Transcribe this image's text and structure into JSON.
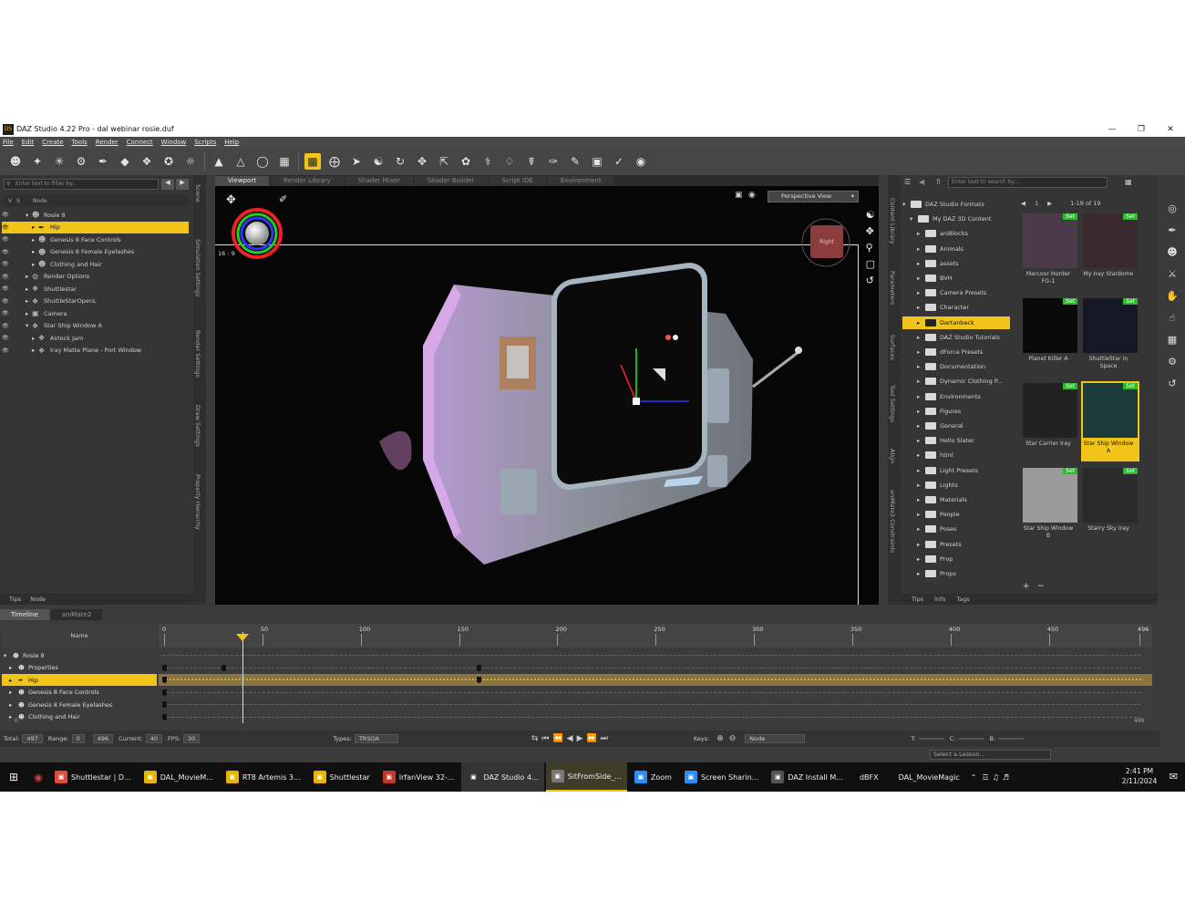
{
  "window": {
    "title": "DAZ Studio 4.22 Pro - dal webinar rosie.duf",
    "app_icon": "DS"
  },
  "menu": [
    "File",
    "Edit",
    "Create",
    "Tools",
    "Render",
    "Connect",
    "Window",
    "Scripts",
    "Help"
  ],
  "scene": {
    "filter_placeholder": "Enter text to filter by...",
    "header": {
      "v": "V",
      "s": "S",
      "node": "Node"
    },
    "rows": [
      {
        "label": "Rosie 8",
        "indent": 0,
        "expanded": true,
        "selected": false
      },
      {
        "label": "Hip",
        "indent": 1,
        "expanded": false,
        "selected": true
      },
      {
        "label": "Genesis 8 Face Controls",
        "indent": 1,
        "expanded": false,
        "selected": false
      },
      {
        "label": "Genesis 8 Female Eyelashes",
        "indent": 1,
        "expanded": false,
        "selected": false
      },
      {
        "label": "Clothing and Hair",
        "indent": 1,
        "expanded": false,
        "selected": false
      },
      {
        "label": "Render Options",
        "indent": 0,
        "expanded": false,
        "selected": false
      },
      {
        "label": "Shuttlestar",
        "indent": 0,
        "expanded": false,
        "selected": false
      },
      {
        "label": "ShuttleStarOpenL",
        "indent": 0,
        "expanded": false,
        "selected": false
      },
      {
        "label": "Camera",
        "indent": 0,
        "expanded": false,
        "selected": false
      },
      {
        "label": "Star Ship Window A",
        "indent": 0,
        "expanded": true,
        "selected": false
      },
      {
        "label": "Airlock Jam",
        "indent": 1,
        "expanded": false,
        "selected": false
      },
      {
        "label": "Iray Matte Plane - Port Window",
        "indent": 1,
        "expanded": false,
        "selected": false
      }
    ],
    "side_tabs": [
      "Scene",
      "Simulation Settings",
      "Render Settings",
      "Draw Settings",
      "Property Hierarchy"
    ],
    "bottom_tabs": [
      "Tips",
      "Node"
    ]
  },
  "viewport": {
    "tabs": [
      "Viewport",
      "Render Library",
      "Shader Mixer",
      "Shader Builder",
      "Script IDE",
      "Environment"
    ],
    "active_tab": "Viewport",
    "view_select": "Perspective View",
    "aspect": "16 : 9",
    "cube_label": "Right"
  },
  "content": {
    "side_tabs": [
      "Content Library",
      "Parameters",
      "Surfaces",
      "Tool Settings",
      "Align",
      "aniMate2 Constraints"
    ],
    "search_placeholder": "Enter text to search by...",
    "page": "1",
    "range": "1-19 of 19",
    "tree": [
      {
        "label": "DAZ Studio Formats",
        "indent": 0,
        "selected": false
      },
      {
        "label": "My DAZ 3D Content",
        "indent": 1,
        "selected": false
      },
      {
        "label": "aniBlocks",
        "indent": 2,
        "selected": false
      },
      {
        "label": "Animals",
        "indent": 2,
        "selected": false
      },
      {
        "label": "assets",
        "indent": 2,
        "selected": false
      },
      {
        "label": "BVH",
        "indent": 2,
        "selected": false
      },
      {
        "label": "Camera Presets",
        "indent": 2,
        "selected": false
      },
      {
        "label": "Character",
        "indent": 2,
        "selected": false
      },
      {
        "label": "Dartanbeck",
        "indent": 2,
        "selected": true
      },
      {
        "label": "DAZ Studio Tutorials",
        "indent": 2,
        "selected": false
      },
      {
        "label": "dForce Presets",
        "indent": 2,
        "selected": false
      },
      {
        "label": "Documentation",
        "indent": 2,
        "selected": false
      },
      {
        "label": "Dynamic Clothing P...",
        "indent": 2,
        "selected": false
      },
      {
        "label": "Environments",
        "indent": 2,
        "selected": false
      },
      {
        "label": "Figures",
        "indent": 2,
        "selected": false
      },
      {
        "label": "General",
        "indent": 2,
        "selected": false
      },
      {
        "label": "Hello Slater",
        "indent": 2,
        "selected": false
      },
      {
        "label": "html",
        "indent": 2,
        "selected": false
      },
      {
        "label": "Light Presets",
        "indent": 2,
        "selected": false
      },
      {
        "label": "Lights",
        "indent": 2,
        "selected": false
      },
      {
        "label": "Materials",
        "indent": 2,
        "selected": false
      },
      {
        "label": "People",
        "indent": 2,
        "selected": false
      },
      {
        "label": "Poses",
        "indent": 2,
        "selected": false
      },
      {
        "label": "Presets",
        "indent": 2,
        "selected": false
      },
      {
        "label": "Prop",
        "indent": 2,
        "selected": false
      },
      {
        "label": "Props",
        "indent": 2,
        "selected": false
      }
    ],
    "set_badge": "Set",
    "thumbs": [
      {
        "label": "Marcoor Hunter FG-1",
        "selected": false,
        "bg": "#4a3a4a"
      },
      {
        "label": "My Iray Stardome",
        "selected": false,
        "bg": "#3a2a30"
      },
      {
        "label": "Planet Killer A",
        "selected": false,
        "bg": "#0a0a0a"
      },
      {
        "label": "ShuttleStar in Space",
        "selected": false,
        "bg": "#151822"
      },
      {
        "label": "Star Carrier Iray",
        "selected": false,
        "bg": "#222"
      },
      {
        "label": "Star Ship Window A",
        "selected": true,
        "bg": "#1d3a3a"
      },
      {
        "label": "Star Ship Window B",
        "selected": false,
        "bg": "#9a9a9a"
      },
      {
        "label": "Starry Sky Iray",
        "selected": false,
        "bg": "#2a2a2a"
      }
    ],
    "bottom_tabs": [
      "Tips",
      "Info",
      "Tags"
    ]
  },
  "timeline": {
    "tabs": [
      "Timeline",
      "aniMate2"
    ],
    "name_header": "Name",
    "ticks": [
      "0",
      "50",
      "100",
      "150",
      "200",
      "250",
      "300",
      "350",
      "400",
      "450",
      "496"
    ],
    "rows": [
      {
        "label": "Rosie 8",
        "selected": false,
        "keys": []
      },
      {
        "label": "Properties",
        "selected": false,
        "keys": [
          0,
          30,
          160
        ]
      },
      {
        "label": "Hip",
        "selected": true,
        "keys": [
          0,
          160
        ]
      },
      {
        "label": "Genesis 8 Face Controls",
        "selected": false,
        "keys": [
          0
        ]
      },
      {
        "label": "Genesis 8 Female Eyelashes",
        "selected": false,
        "keys": [
          0
        ]
      },
      {
        "label": "Clothing and Hair",
        "selected": false,
        "keys": [
          0
        ]
      }
    ],
    "scroll_start": "0",
    "scroll_end": "496",
    "current_frame": 40,
    "total_frames": 496,
    "status": {
      "total_label": "Total:",
      "total": "497",
      "range_label": "Range:",
      "range_start": "0",
      "range_end": "496",
      "current_label": "Current:",
      "current": "40",
      "fps_label": "FPS:",
      "fps": "30",
      "types_label": "Types:",
      "types": "TRSOA",
      "keys_label": "Keys:",
      "keys_mode": "Node",
      "t_label": "T:",
      "c_label": "C:",
      "b_label": "B:"
    }
  },
  "lesson_select": "Select a Lesson...",
  "taskbar": {
    "items": [
      {
        "label": "Shuttlestar | D...",
        "color": "#dd4b39",
        "active": false
      },
      {
        "label": "DAL_MovieM...",
        "color": "#e8b400",
        "active": false
      },
      {
        "label": "RT8 Artemis 3...",
        "color": "#e8b400",
        "active": false
      },
      {
        "label": "Shuttlestar",
        "color": "#e8b400",
        "active": false
      },
      {
        "label": "IrfanView 32-...",
        "color": "#c0392b",
        "active": false
      },
      {
        "label": "DAZ Studio 4...",
        "color": "#333",
        "active": true
      },
      {
        "label": "SitFromSide_...",
        "color": "#777",
        "active": true,
        "highlight": true
      },
      {
        "label": "Zoom",
        "color": "#2d8cff",
        "active": false
      },
      {
        "label": "Screen Sharin...",
        "color": "#2d8cff",
        "active": false
      },
      {
        "label": "DAZ Install M...",
        "color": "#555",
        "active": false
      }
    ],
    "tray_labels": [
      "dBFX",
      "DAL_MovieMagic"
    ],
    "time": "2:41 PM",
    "date": "2/11/2024"
  }
}
